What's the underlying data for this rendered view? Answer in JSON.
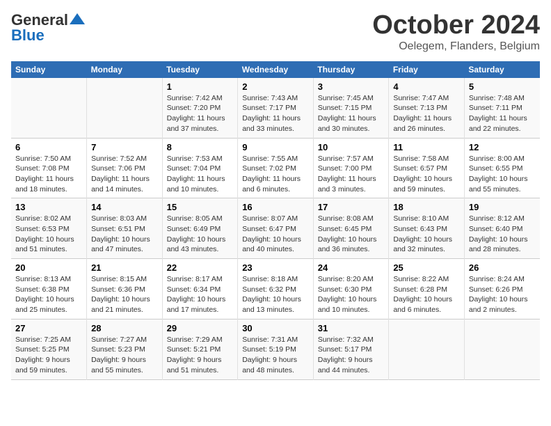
{
  "header": {
    "logo_general": "General",
    "logo_blue": "Blue",
    "month_title": "October 2024",
    "location": "Oelegem, Flanders, Belgium"
  },
  "days_of_week": [
    "Sunday",
    "Monday",
    "Tuesday",
    "Wednesday",
    "Thursday",
    "Friday",
    "Saturday"
  ],
  "weeks": [
    [
      {
        "day": "",
        "sunrise": "",
        "sunset": "",
        "daylight": ""
      },
      {
        "day": "",
        "sunrise": "",
        "sunset": "",
        "daylight": ""
      },
      {
        "day": "1",
        "sunrise": "Sunrise: 7:42 AM",
        "sunset": "Sunset: 7:20 PM",
        "daylight": "Daylight: 11 hours and 37 minutes."
      },
      {
        "day": "2",
        "sunrise": "Sunrise: 7:43 AM",
        "sunset": "Sunset: 7:17 PM",
        "daylight": "Daylight: 11 hours and 33 minutes."
      },
      {
        "day": "3",
        "sunrise": "Sunrise: 7:45 AM",
        "sunset": "Sunset: 7:15 PM",
        "daylight": "Daylight: 11 hours and 30 minutes."
      },
      {
        "day": "4",
        "sunrise": "Sunrise: 7:47 AM",
        "sunset": "Sunset: 7:13 PM",
        "daylight": "Daylight: 11 hours and 26 minutes."
      },
      {
        "day": "5",
        "sunrise": "Sunrise: 7:48 AM",
        "sunset": "Sunset: 7:11 PM",
        "daylight": "Daylight: 11 hours and 22 minutes."
      }
    ],
    [
      {
        "day": "6",
        "sunrise": "Sunrise: 7:50 AM",
        "sunset": "Sunset: 7:08 PM",
        "daylight": "Daylight: 11 hours and 18 minutes."
      },
      {
        "day": "7",
        "sunrise": "Sunrise: 7:52 AM",
        "sunset": "Sunset: 7:06 PM",
        "daylight": "Daylight: 11 hours and 14 minutes."
      },
      {
        "day": "8",
        "sunrise": "Sunrise: 7:53 AM",
        "sunset": "Sunset: 7:04 PM",
        "daylight": "Daylight: 11 hours and 10 minutes."
      },
      {
        "day": "9",
        "sunrise": "Sunrise: 7:55 AM",
        "sunset": "Sunset: 7:02 PM",
        "daylight": "Daylight: 11 hours and 6 minutes."
      },
      {
        "day": "10",
        "sunrise": "Sunrise: 7:57 AM",
        "sunset": "Sunset: 7:00 PM",
        "daylight": "Daylight: 11 hours and 3 minutes."
      },
      {
        "day": "11",
        "sunrise": "Sunrise: 7:58 AM",
        "sunset": "Sunset: 6:57 PM",
        "daylight": "Daylight: 10 hours and 59 minutes."
      },
      {
        "day": "12",
        "sunrise": "Sunrise: 8:00 AM",
        "sunset": "Sunset: 6:55 PM",
        "daylight": "Daylight: 10 hours and 55 minutes."
      }
    ],
    [
      {
        "day": "13",
        "sunrise": "Sunrise: 8:02 AM",
        "sunset": "Sunset: 6:53 PM",
        "daylight": "Daylight: 10 hours and 51 minutes."
      },
      {
        "day": "14",
        "sunrise": "Sunrise: 8:03 AM",
        "sunset": "Sunset: 6:51 PM",
        "daylight": "Daylight: 10 hours and 47 minutes."
      },
      {
        "day": "15",
        "sunrise": "Sunrise: 8:05 AM",
        "sunset": "Sunset: 6:49 PM",
        "daylight": "Daylight: 10 hours and 43 minutes."
      },
      {
        "day": "16",
        "sunrise": "Sunrise: 8:07 AM",
        "sunset": "Sunset: 6:47 PM",
        "daylight": "Daylight: 10 hours and 40 minutes."
      },
      {
        "day": "17",
        "sunrise": "Sunrise: 8:08 AM",
        "sunset": "Sunset: 6:45 PM",
        "daylight": "Daylight: 10 hours and 36 minutes."
      },
      {
        "day": "18",
        "sunrise": "Sunrise: 8:10 AM",
        "sunset": "Sunset: 6:43 PM",
        "daylight": "Daylight: 10 hours and 32 minutes."
      },
      {
        "day": "19",
        "sunrise": "Sunrise: 8:12 AM",
        "sunset": "Sunset: 6:40 PM",
        "daylight": "Daylight: 10 hours and 28 minutes."
      }
    ],
    [
      {
        "day": "20",
        "sunrise": "Sunrise: 8:13 AM",
        "sunset": "Sunset: 6:38 PM",
        "daylight": "Daylight: 10 hours and 25 minutes."
      },
      {
        "day": "21",
        "sunrise": "Sunrise: 8:15 AM",
        "sunset": "Sunset: 6:36 PM",
        "daylight": "Daylight: 10 hours and 21 minutes."
      },
      {
        "day": "22",
        "sunrise": "Sunrise: 8:17 AM",
        "sunset": "Sunset: 6:34 PM",
        "daylight": "Daylight: 10 hours and 17 minutes."
      },
      {
        "day": "23",
        "sunrise": "Sunrise: 8:18 AM",
        "sunset": "Sunset: 6:32 PM",
        "daylight": "Daylight: 10 hours and 13 minutes."
      },
      {
        "day": "24",
        "sunrise": "Sunrise: 8:20 AM",
        "sunset": "Sunset: 6:30 PM",
        "daylight": "Daylight: 10 hours and 10 minutes."
      },
      {
        "day": "25",
        "sunrise": "Sunrise: 8:22 AM",
        "sunset": "Sunset: 6:28 PM",
        "daylight": "Daylight: 10 hours and 6 minutes."
      },
      {
        "day": "26",
        "sunrise": "Sunrise: 8:24 AM",
        "sunset": "Sunset: 6:26 PM",
        "daylight": "Daylight: 10 hours and 2 minutes."
      }
    ],
    [
      {
        "day": "27",
        "sunrise": "Sunrise: 7:25 AM",
        "sunset": "Sunset: 5:25 PM",
        "daylight": "Daylight: 9 hours and 59 minutes."
      },
      {
        "day": "28",
        "sunrise": "Sunrise: 7:27 AM",
        "sunset": "Sunset: 5:23 PM",
        "daylight": "Daylight: 9 hours and 55 minutes."
      },
      {
        "day": "29",
        "sunrise": "Sunrise: 7:29 AM",
        "sunset": "Sunset: 5:21 PM",
        "daylight": "Daylight: 9 hours and 51 minutes."
      },
      {
        "day": "30",
        "sunrise": "Sunrise: 7:31 AM",
        "sunset": "Sunset: 5:19 PM",
        "daylight": "Daylight: 9 hours and 48 minutes."
      },
      {
        "day": "31",
        "sunrise": "Sunrise: 7:32 AM",
        "sunset": "Sunset: 5:17 PM",
        "daylight": "Daylight: 9 hours and 44 minutes."
      },
      {
        "day": "",
        "sunrise": "",
        "sunset": "",
        "daylight": ""
      },
      {
        "day": "",
        "sunrise": "",
        "sunset": "",
        "daylight": ""
      }
    ]
  ]
}
